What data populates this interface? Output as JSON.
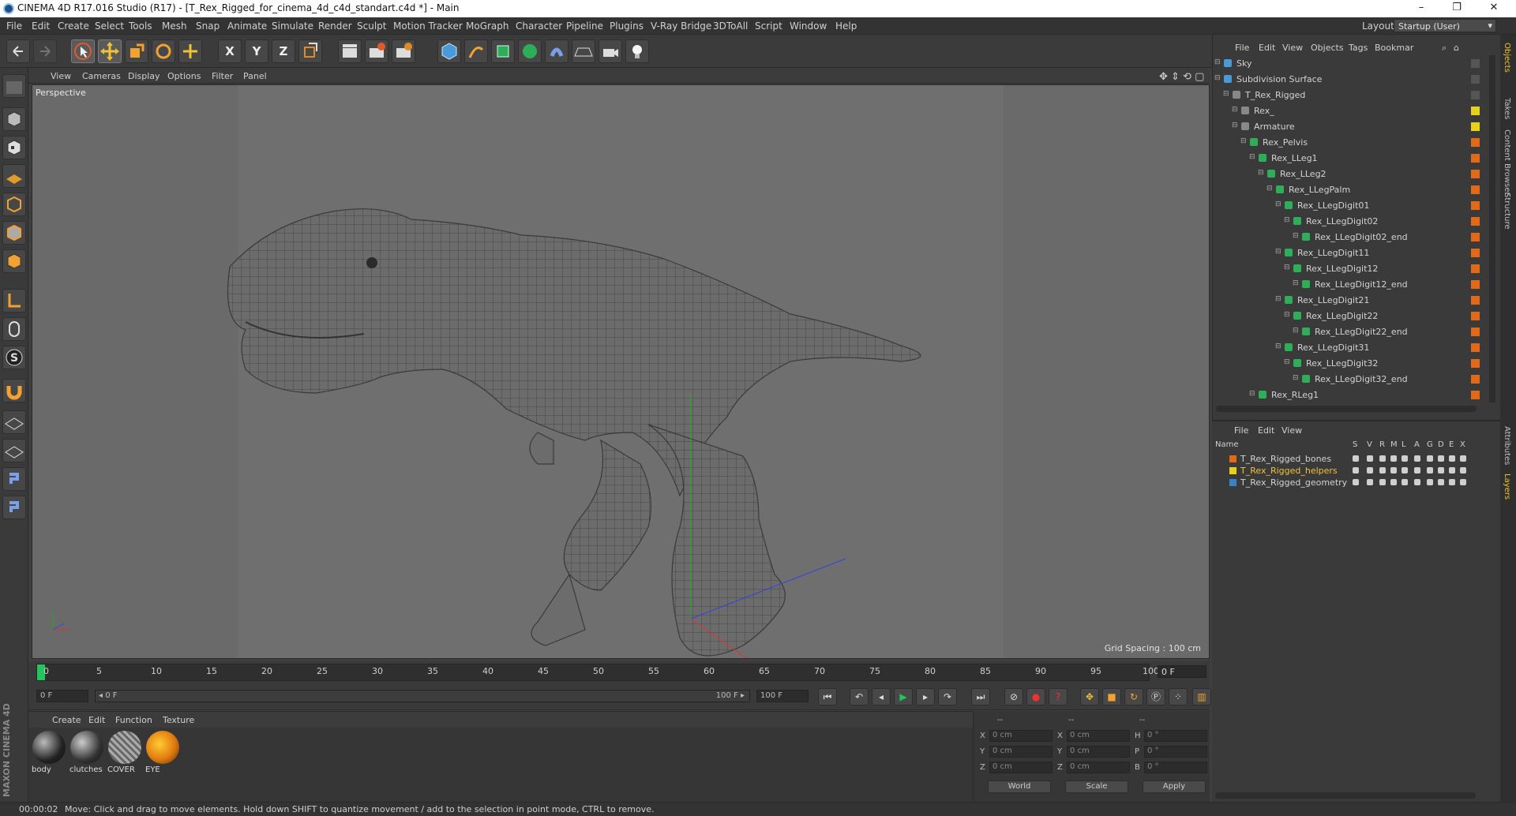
{
  "window": {
    "title": "CINEMA 4D R17.016 Studio (R17) - [T_Rex_Rigged_for_cinema_4d_c4d_standart.c4d *] - Main",
    "minimize": "–",
    "maximize": "❐",
    "close": "✕"
  },
  "menu": [
    "File",
    "Edit",
    "Create",
    "Select",
    "Tools",
    "Mesh",
    "Snap",
    "Animate",
    "Simulate",
    "Render",
    "Sculpt",
    "Motion Tracker",
    "MoGraph",
    "Character",
    "Pipeline",
    "Plugins",
    "V-Ray Bridge",
    "3DToAll",
    "Script",
    "Window",
    "Help"
  ],
  "layout": {
    "label": "Layout:",
    "value": "Startup (User)"
  },
  "toolbar": {
    "axis_x": "X",
    "axis_y": "Y",
    "axis_z": "Z"
  },
  "viewport": {
    "menu": [
      "View",
      "Cameras",
      "Display",
      "Options",
      "Filter",
      "Panel"
    ],
    "camera_label": "Perspective",
    "grid_spacing": "Grid Spacing : 100 cm"
  },
  "timeline": {
    "ticks": [
      "0",
      "5",
      "10",
      "15",
      "20",
      "25",
      "30",
      "35",
      "40",
      "45",
      "50",
      "55",
      "60",
      "65",
      "70",
      "75",
      "80",
      "85",
      "90",
      "95",
      "100"
    ],
    "current_frame": "0 F",
    "start_frame": "0 F",
    "range_start": "◂ 0 F",
    "range_end": "100 F ▸",
    "end_frame": "100 F"
  },
  "materials": {
    "menu": [
      "Create",
      "Edit",
      "Function",
      "Texture"
    ],
    "items": [
      {
        "label": "body"
      },
      {
        "label": "clutches"
      },
      {
        "label": "COVER"
      },
      {
        "label": "EYE"
      }
    ]
  },
  "branding": "MAXON CINEMA 4D",
  "coordinates": {
    "header_dashes": [
      "--",
      "--",
      "--"
    ],
    "rows": [
      {
        "a": "X",
        "av": "0 cm",
        "b": "X",
        "bv": "0 cm",
        "c": "H",
        "cv": "0 °"
      },
      {
        "a": "Y",
        "av": "0 cm",
        "b": "Y",
        "bv": "0 cm",
        "c": "P",
        "cv": "0 °"
      },
      {
        "a": "Z",
        "av": "0 cm",
        "b": "Z",
        "bv": "0 cm",
        "c": "B",
        "cv": "0 °"
      }
    ],
    "world": "World",
    "scale": "Scale",
    "apply": "Apply"
  },
  "objects_panel": {
    "menu": [
      "File",
      "Edit",
      "View",
      "Objects",
      "Tags",
      "Bookmar"
    ],
    "items": [
      {
        "name": "Sky",
        "depth": 0,
        "chip": "#555555"
      },
      {
        "name": "Subdivision Surface",
        "depth": 0,
        "chip": "#555555"
      },
      {
        "name": "T_Rex_Rigged",
        "depth": 1,
        "chip": "#555555"
      },
      {
        "name": "Rex_",
        "depth": 2,
        "chip": "#e6d21c"
      },
      {
        "name": "Armature",
        "depth": 2,
        "chip": "#e6d21c"
      },
      {
        "name": "Rex_Pelvis",
        "depth": 3,
        "chip": "#e06a1a"
      },
      {
        "name": "Rex_LLeg1",
        "depth": 4,
        "chip": "#e06a1a"
      },
      {
        "name": "Rex_LLeg2",
        "depth": 5,
        "chip": "#e06a1a"
      },
      {
        "name": "Rex_LLegPalm",
        "depth": 6,
        "chip": "#e06a1a"
      },
      {
        "name": "Rex_LLegDigit01",
        "depth": 7,
        "chip": "#e06a1a"
      },
      {
        "name": "Rex_LLegDigit02",
        "depth": 8,
        "chip": "#e06a1a"
      },
      {
        "name": "Rex_LLegDigit02_end",
        "depth": 9,
        "chip": "#e06a1a"
      },
      {
        "name": "Rex_LLegDigit11",
        "depth": 7,
        "chip": "#e06a1a"
      },
      {
        "name": "Rex_LLegDigit12",
        "depth": 8,
        "chip": "#e06a1a"
      },
      {
        "name": "Rex_LLegDigit12_end",
        "depth": 9,
        "chip": "#e06a1a"
      },
      {
        "name": "Rex_LLegDigit21",
        "depth": 7,
        "chip": "#e06a1a"
      },
      {
        "name": "Rex_LLegDigit22",
        "depth": 8,
        "chip": "#e06a1a"
      },
      {
        "name": "Rex_LLegDigit22_end",
        "depth": 9,
        "chip": "#e06a1a"
      },
      {
        "name": "Rex_LLegDigit31",
        "depth": 7,
        "chip": "#e06a1a"
      },
      {
        "name": "Rex_LLegDigit32",
        "depth": 8,
        "chip": "#e06a1a"
      },
      {
        "name": "Rex_LLegDigit32_end",
        "depth": 9,
        "chip": "#e06a1a"
      },
      {
        "name": "Rex_RLeg1",
        "depth": 4,
        "chip": "#e06a1a"
      }
    ]
  },
  "layers_panel": {
    "menu": [
      "File",
      "Edit",
      "View"
    ],
    "headers": [
      "Name",
      "S",
      "V",
      "R",
      "M",
      "L",
      "A",
      "G",
      "D",
      "E",
      "X"
    ],
    "items": [
      {
        "name": "T_Rex_Rigged_bones",
        "color": "#e06a1a",
        "text_color": "#d2d2d2"
      },
      {
        "name": "T_Rex_Rigged_helpers",
        "color": "#e6d21c",
        "text_color": "#f0c040"
      },
      {
        "name": "T_Rex_Rigged_geometry",
        "color": "#3b82c4",
        "text_color": "#d2d2d2"
      }
    ]
  },
  "side_tabs": [
    "Objects",
    "Takes",
    "Content Browser",
    "Structure",
    "Attributes",
    "Layers"
  ],
  "status": {
    "time": "00:00:02",
    "message": "Move: Click and drag to move elements. Hold down SHIFT to quantize movement / add to the selection in point mode, CTRL to remove."
  }
}
